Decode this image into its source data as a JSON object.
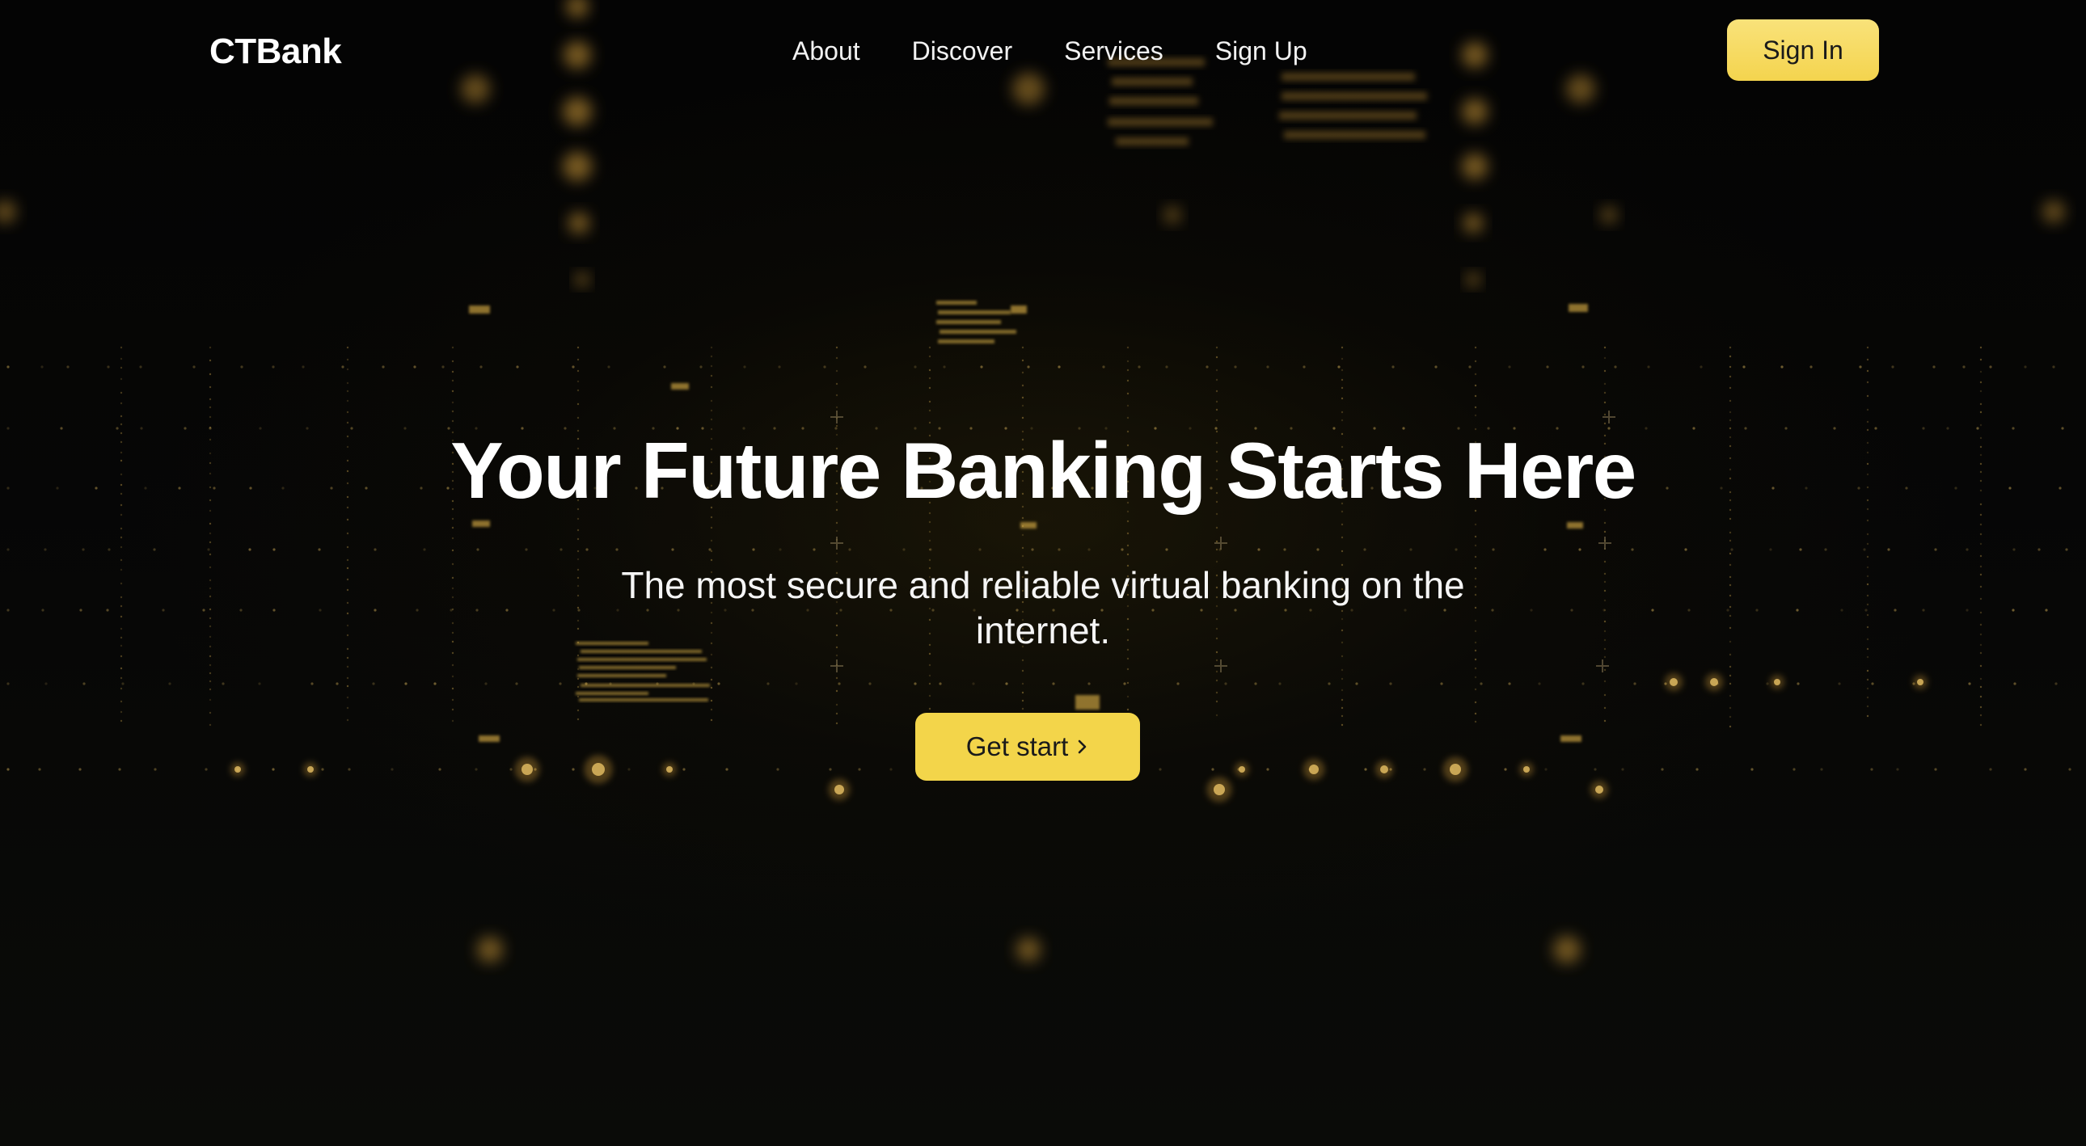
{
  "brand": {
    "name": "CTBank"
  },
  "nav": {
    "links": [
      "About",
      "Discover",
      "Services",
      "Sign Up"
    ],
    "sign_in_label": "Sign In"
  },
  "hero": {
    "title": "Your Future Banking Starts Here",
    "subtitle": "The most secure and reliable virtual banking on the internet.",
    "cta_label": "Get start",
    "cta_icon": "chevron-right-icon"
  },
  "colors": {
    "background": "#050505",
    "accent": "#f3d54a",
    "accent_light": "#f9e27a",
    "text": "#ffffff",
    "button_text": "#1a1a1a",
    "glow": "#d9a23a"
  }
}
